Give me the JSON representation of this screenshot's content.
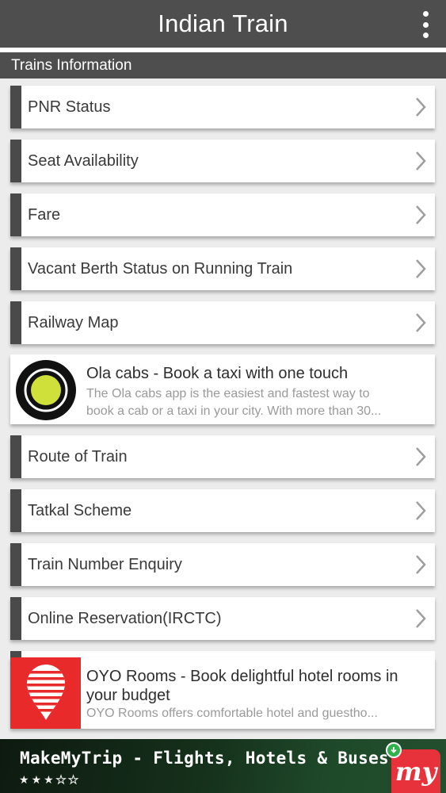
{
  "app": {
    "title": "Indian Train"
  },
  "section": {
    "title": "Trains Information"
  },
  "menu_items": [
    {
      "label": "PNR Status"
    },
    {
      "label": "Seat Availability"
    },
    {
      "label": "Fare"
    },
    {
      "label": "Vacant Berth Status on Running Train"
    },
    {
      "label": "Railway Map"
    },
    {
      "label": "Route of Train"
    },
    {
      "label": "Tatkal Scheme"
    },
    {
      "label": "Train Number Enquiry"
    },
    {
      "label": "Online Reservation(IRCTC)"
    }
  ],
  "ads": {
    "ola": {
      "title": "Ola cabs - Book a taxi with one touch",
      "desc_line1": "The Ola cabs app is the easiest and fastest way to",
      "desc_line2": "book a cab or a taxi in your city. With more than 30..."
    },
    "oyo": {
      "title": "OYO Rooms - Book delightful hotel rooms in your budget",
      "desc": "OYO Rooms offers comfortable hotel and guestho..."
    },
    "banner": {
      "title": "MakeMyTrip - Flights, Hotels & Buses",
      "rating": 3,
      "rating_max": 5,
      "logo_text": "my"
    }
  },
  "colors": {
    "appbar": "#4e4e4e",
    "accent_bar": "#4a4a4a",
    "oyo_red": "#e92a2b",
    "ola_green": "#cfe03a",
    "mmt_red": "#e7323b"
  },
  "icons": {
    "menu": "kebab-menu-icon",
    "row_arrow": "chevron-right-icon",
    "ola": "ola-logo-icon",
    "oyo": "oyo-logo-icon",
    "mmt": "makemytrip-logo-icon",
    "install": "download-badge-icon"
  }
}
